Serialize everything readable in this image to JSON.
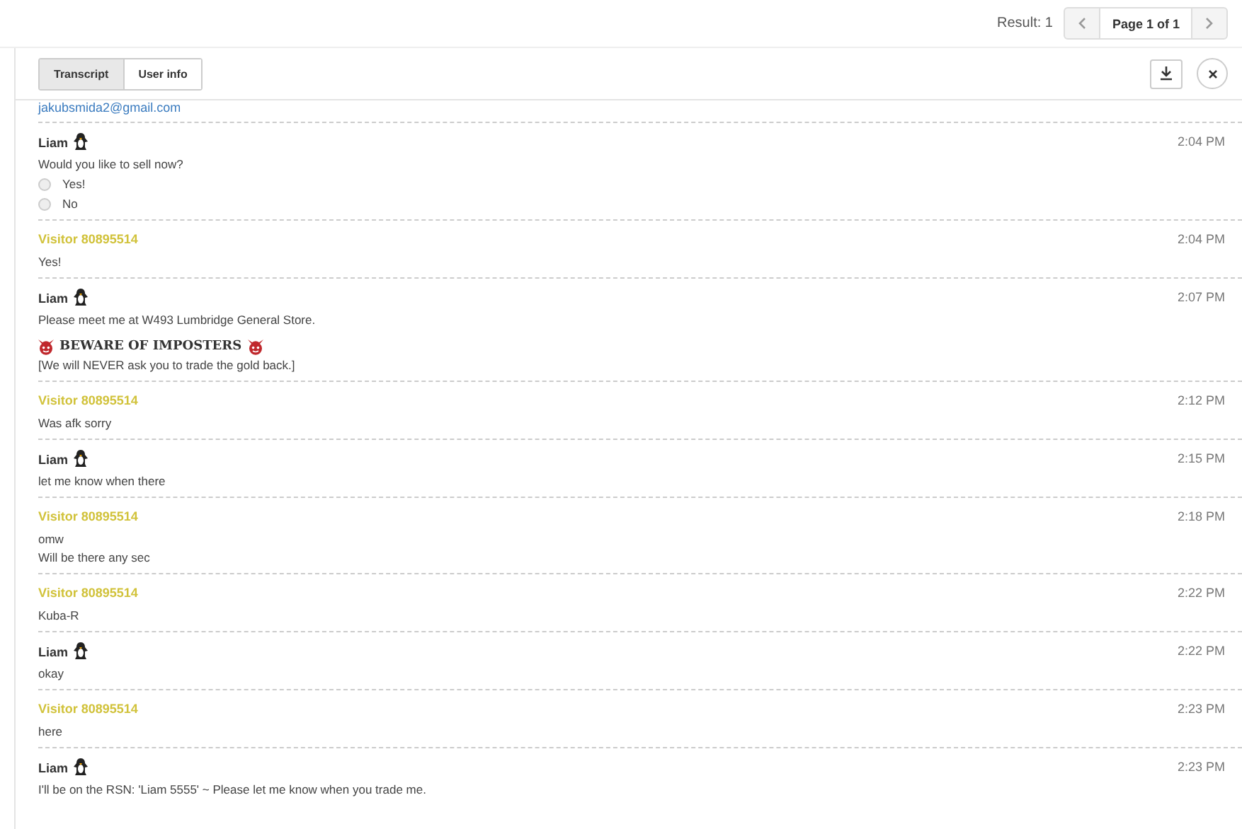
{
  "top_bar": {
    "result": "Result: 1",
    "page": "Page 1 of 1"
  },
  "tabs": [
    {
      "label": "Transcript",
      "selected": true
    },
    {
      "label": "User info",
      "selected": false
    }
  ],
  "email": "jakubsmida2@gmail.com",
  "messages": [
    {
      "author": "Liam",
      "kind": "agent",
      "time": "2:04 PM",
      "lines": [
        "Would you like to sell now?"
      ],
      "options": [
        {
          "label": "Yes!",
          "selected": false
        },
        {
          "label": "No",
          "selected": false
        }
      ]
    },
    {
      "author": "Visitor 80895514",
      "kind": "visitor",
      "time": "2:04 PM",
      "lines": [
        "Yes!"
      ]
    },
    {
      "author": "Liam",
      "kind": "agent",
      "time": "2:07 PM",
      "lines": [
        "Please meet me at W493 Lumbridge General Store."
      ],
      "warning": {
        "title": "BEWARE OF IMPOSTERS",
        "note": "[We will NEVER ask you to trade the gold back.]"
      }
    },
    {
      "author": "Visitor 80895514",
      "kind": "visitor",
      "time": "2:12 PM",
      "lines": [
        "Was afk sorry"
      ]
    },
    {
      "author": "Liam",
      "kind": "agent",
      "time": "2:15 PM",
      "lines": [
        "let me know when there"
      ]
    },
    {
      "author": "Visitor 80895514",
      "kind": "visitor",
      "time": "2:18 PM",
      "lines": [
        "omw",
        "Will be there any sec"
      ]
    },
    {
      "author": "Visitor 80895514",
      "kind": "visitor",
      "time": "2:22 PM",
      "lines": [
        "Kuba-R"
      ]
    },
    {
      "author": "Liam",
      "kind": "agent",
      "time": "2:22 PM",
      "lines": [
        "okay"
      ]
    },
    {
      "author": "Visitor 80895514",
      "kind": "visitor",
      "time": "2:23 PM",
      "lines": [
        "here"
      ]
    },
    {
      "author": "Liam",
      "kind": "agent",
      "time": "2:23 PM",
      "lines": [
        "I'll be on the RSN: 'Liam 5555' ~ Please let me know when you trade me."
      ]
    }
  ]
}
